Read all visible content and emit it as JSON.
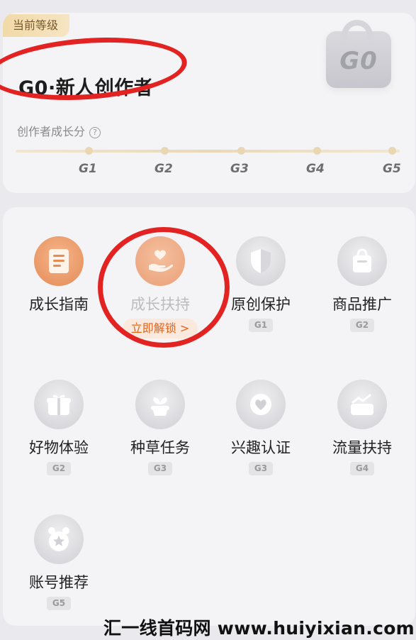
{
  "level": {
    "tag": "当前等级",
    "title": "G0·新人创作者",
    "growth_label": "创作者成长分",
    "help_glyph": "?",
    "badge_text": "G0",
    "milestones": [
      "G1",
      "G2",
      "G3",
      "G4",
      "G5"
    ]
  },
  "features": [
    {
      "label": "成长指南",
      "icon": "document-icon",
      "style": "orange"
    },
    {
      "label": "成长扶持",
      "icon": "heart-hand-icon",
      "style": "orange-soft",
      "action": "立即解锁",
      "action_arrow": ">"
    },
    {
      "label": "原创保护",
      "icon": "shield-icon",
      "style": "gray",
      "grade": "G1"
    },
    {
      "label": "商品推广",
      "icon": "shopping-bag-icon",
      "style": "gray",
      "grade": "G2"
    },
    {
      "label": "好物体验",
      "icon": "gift-box-icon",
      "style": "gray",
      "grade": "G2"
    },
    {
      "label": "种草任务",
      "icon": "sprout-pot-icon",
      "style": "gray",
      "grade": "G3"
    },
    {
      "label": "兴趣认证",
      "icon": "heart-badge-icon",
      "style": "gray",
      "grade": "G3"
    },
    {
      "label": "流量扶持",
      "icon": "trend-icon",
      "style": "gray",
      "grade": "G4"
    },
    {
      "label": "账号推荐",
      "icon": "star-medal-icon",
      "style": "gray",
      "grade": "G5"
    }
  ],
  "watermark": "汇一线首码网 www.huiyixian.com",
  "colors": {
    "accent_orange": "#e48b57",
    "annotation_red": "#e32222",
    "tag_gold": "#f1d9a8"
  }
}
